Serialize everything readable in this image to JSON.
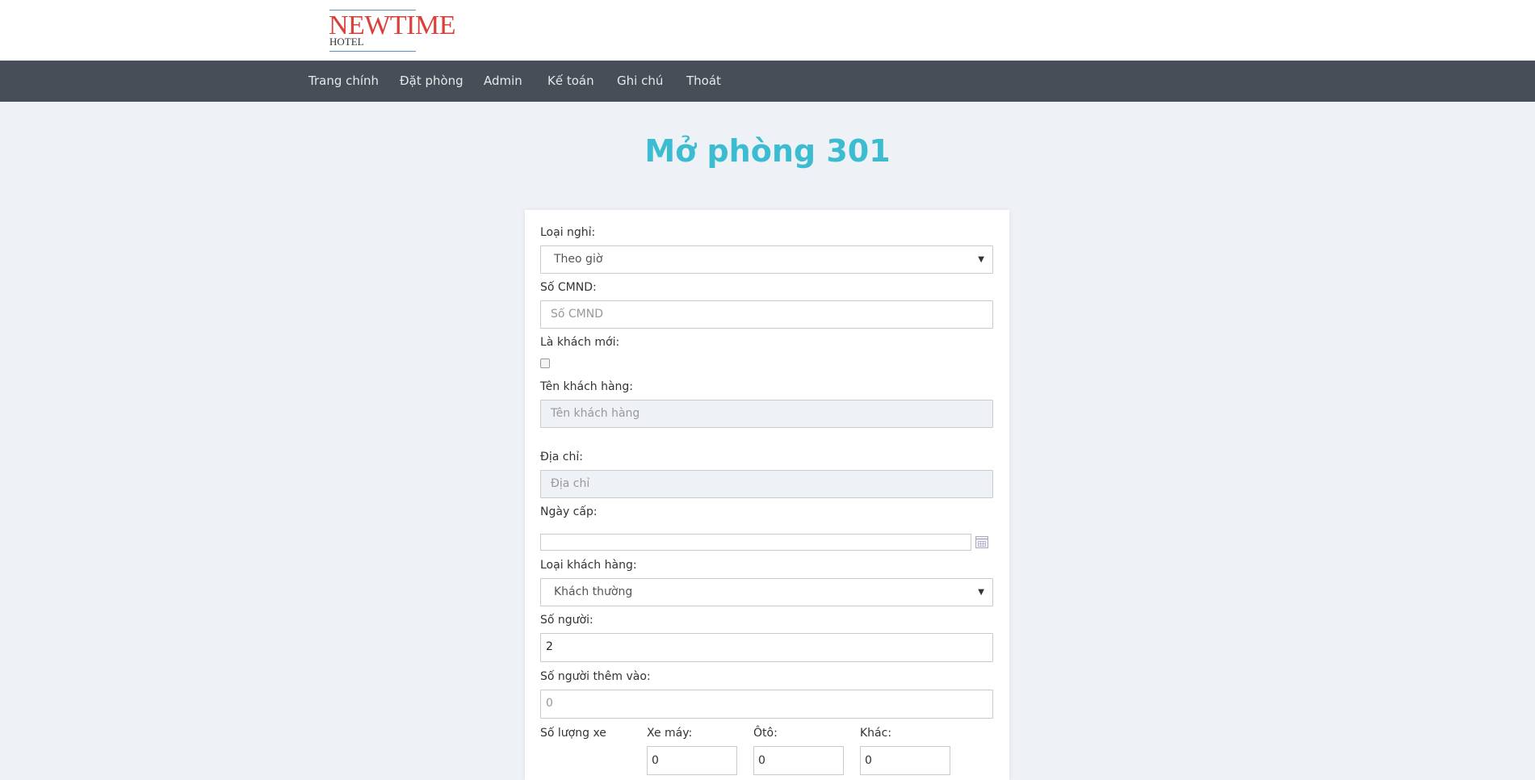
{
  "logo": {
    "brand": "NEWTIME",
    "sub": "HOTEL"
  },
  "nav": {
    "items": [
      {
        "label": "Trang chính"
      },
      {
        "label": "Đặt phòng"
      },
      {
        "label": "Admin"
      },
      {
        "label": "Kế toán"
      },
      {
        "label": "Ghi chú"
      },
      {
        "label": "Thoát"
      }
    ]
  },
  "page": {
    "title": "Mở phòng 301"
  },
  "form": {
    "loai_nghi": {
      "label": "Loại nghỉ:",
      "value": "Theo giờ"
    },
    "so_cmnd": {
      "label": "Số CMND:",
      "placeholder": "Số CMND"
    },
    "khach_moi": {
      "label": "Là khách mới:",
      "checked": false
    },
    "ten_khach": {
      "label": "Tên khách hàng:",
      "placeholder": "Tên khách hàng"
    },
    "dia_chi": {
      "label": "Địa chỉ:",
      "placeholder": "Địa chỉ"
    },
    "ngay_cap": {
      "label": "Ngày cấp:",
      "value": ""
    },
    "loai_khach": {
      "label": "Loại khách hàng:",
      "value": "Khách thường"
    },
    "so_nguoi": {
      "label": "Số người:",
      "value": "2"
    },
    "so_nguoi_them": {
      "label": "Số người thêm vào:",
      "placeholder": "0"
    },
    "so_luong_xe": {
      "label": "Số lượng xe",
      "xe_may": {
        "label": "Xe máy:",
        "value": "0"
      },
      "oto": {
        "label": "Ôtô:",
        "value": "0"
      },
      "khac": {
        "label": "Khác:",
        "value": "0"
      }
    }
  }
}
